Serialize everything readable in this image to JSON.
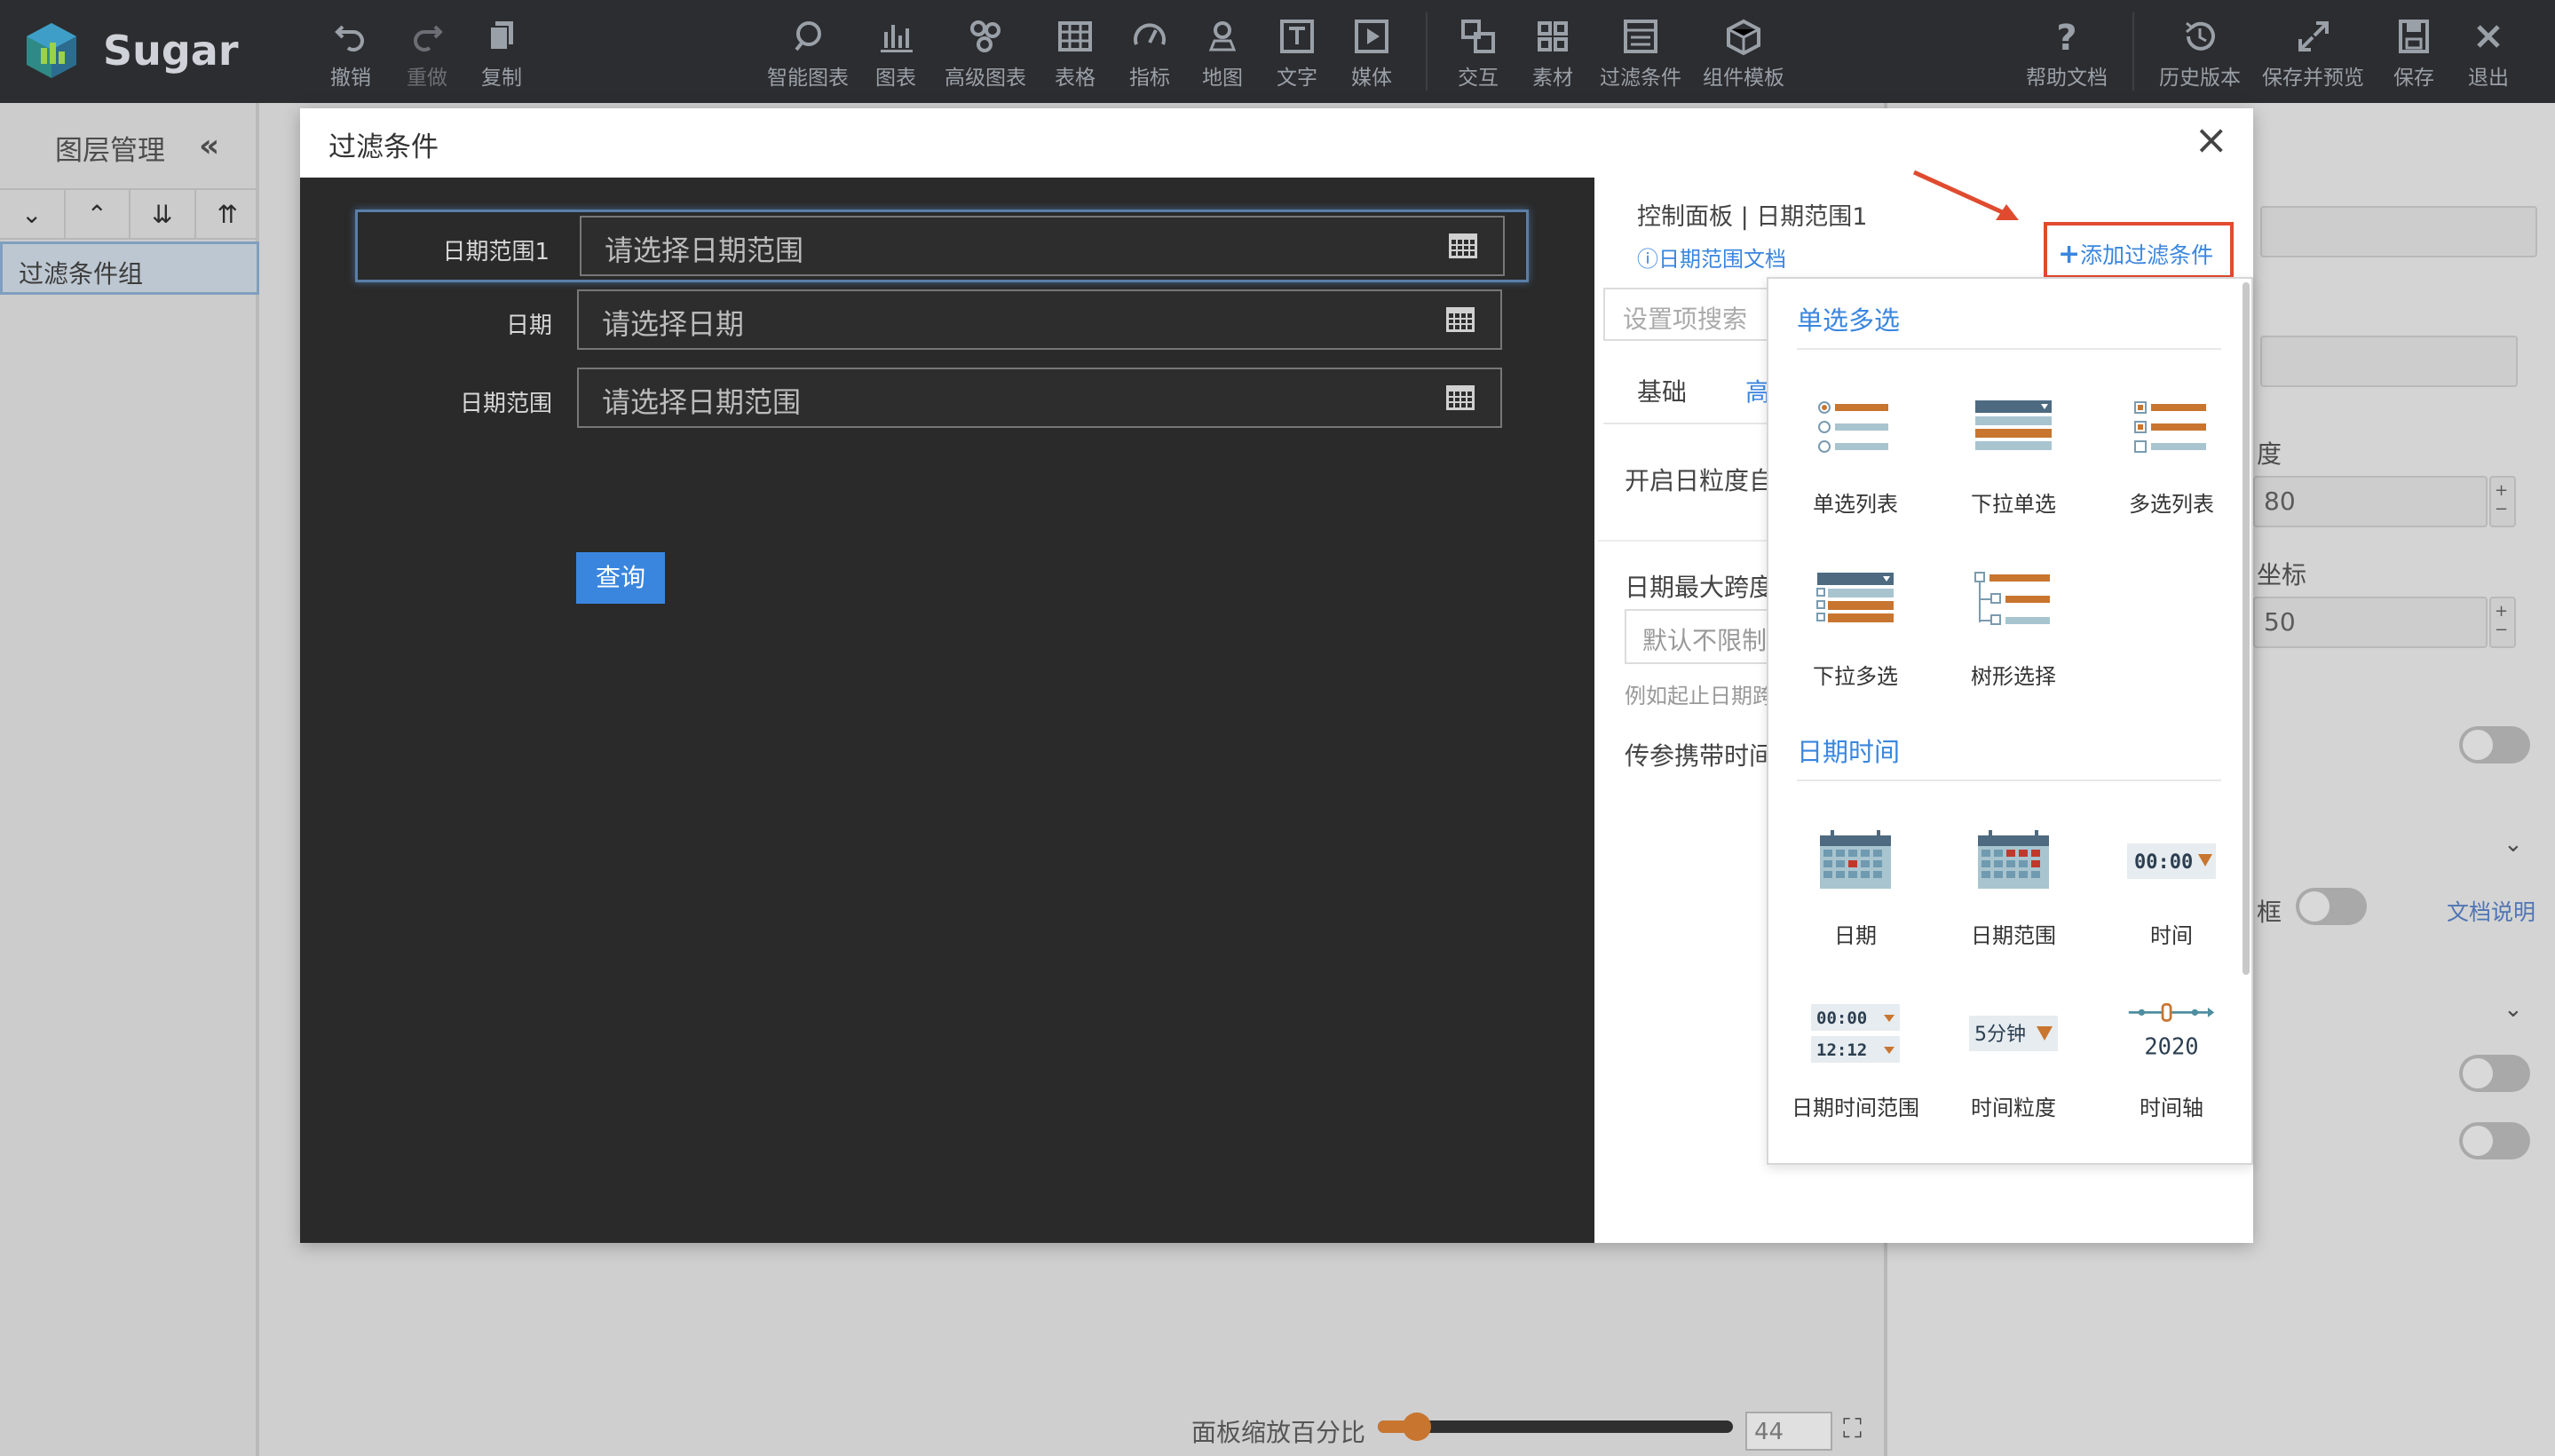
{
  "app": {
    "name": "Sugar"
  },
  "toolbar": {
    "undo": "撤销",
    "redo": "重做",
    "copy": "复制",
    "smart_chart": "智能图表",
    "chart": "图表",
    "advanced_chart": "高级图表",
    "table": "表格",
    "indicator": "指标",
    "map": "地图",
    "text": "文字",
    "media": "媒体",
    "interaction": "交互",
    "material": "素材",
    "filter": "过滤条件",
    "component_template": "组件模板",
    "help": "帮助文档",
    "history": "历史版本",
    "save_preview": "保存并预览",
    "save": "保存",
    "exit": "退出"
  },
  "layer_panel": {
    "title": "图层管理",
    "group": "过滤条件组"
  },
  "zoom": {
    "label": "面板缩放百分比",
    "value": "44",
    "fraction": 0.11
  },
  "right_panel": {
    "label1": "度",
    "value1": "80",
    "label2": "坐标",
    "value2": "50",
    "frame_label": "框",
    "doc_link": "文档说明"
  },
  "dialog": {
    "title": "过滤条件",
    "fields": [
      {
        "label": "日期范围1",
        "placeholder": "请选择日期范围"
      },
      {
        "label": "日期",
        "placeholder": "请选择日期"
      },
      {
        "label": "日期范围",
        "placeholder": "请选择日期范围"
      }
    ],
    "query_button": "查询"
  },
  "control": {
    "title": "控制面板 | 日期范围1",
    "doc_link": "日期范围文档",
    "add_filter": "添加过滤条件",
    "search_placeholder": "设置项搜索",
    "tab_basic": "基础",
    "tab_advanced": "高",
    "granularity_text": "开启日粒度自",
    "max_span": "日期最大跨度",
    "default_unlimited": "默认不限制",
    "example": "例如起止日期跨",
    "pass_param": "传参携带时间"
  },
  "dropdown": {
    "section1": "单选多选",
    "section1_items": [
      "单选列表",
      "下拉单选",
      "多选列表",
      "下拉多选",
      "树形选择"
    ],
    "section2": "日期时间",
    "section2_items": [
      "日期",
      "日期范围",
      "时间",
      "日期时间范围",
      "时间粒度",
      "时间轴"
    ],
    "time_text": "00:00",
    "time_text2": "12:12",
    "granularity_text": "5分钟",
    "year_text": "2020"
  },
  "colors": {
    "accent": "#3a86df",
    "highlight_red": "#e04b2f",
    "orange": "#c8752f"
  }
}
